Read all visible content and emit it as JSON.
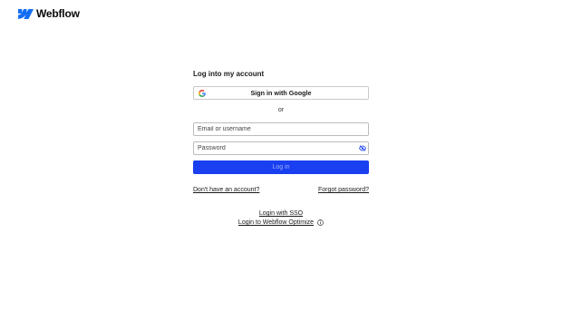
{
  "brand": {
    "name": "Webflow",
    "logo_icon": "webflow-w-icon",
    "color": "#146EF5"
  },
  "login": {
    "title": "Log into my account",
    "google_button": {
      "label": "Sign in with Google",
      "icon": "google-g-icon"
    },
    "divider": "or",
    "email_field": {
      "value": "",
      "placeholder": "Email or username"
    },
    "password_field": {
      "value": "",
      "placeholder": "Password",
      "toggle_icon": "eye-off-icon"
    },
    "submit_button": {
      "label": "Log in",
      "color": "#1A3FF0"
    },
    "links": {
      "signup": "Don't have an account?",
      "forgot_password": "Forgot password?",
      "sso": "Login with SSO",
      "optimize": "Login to Webflow Optimize",
      "optimize_icon": "info-icon"
    }
  }
}
